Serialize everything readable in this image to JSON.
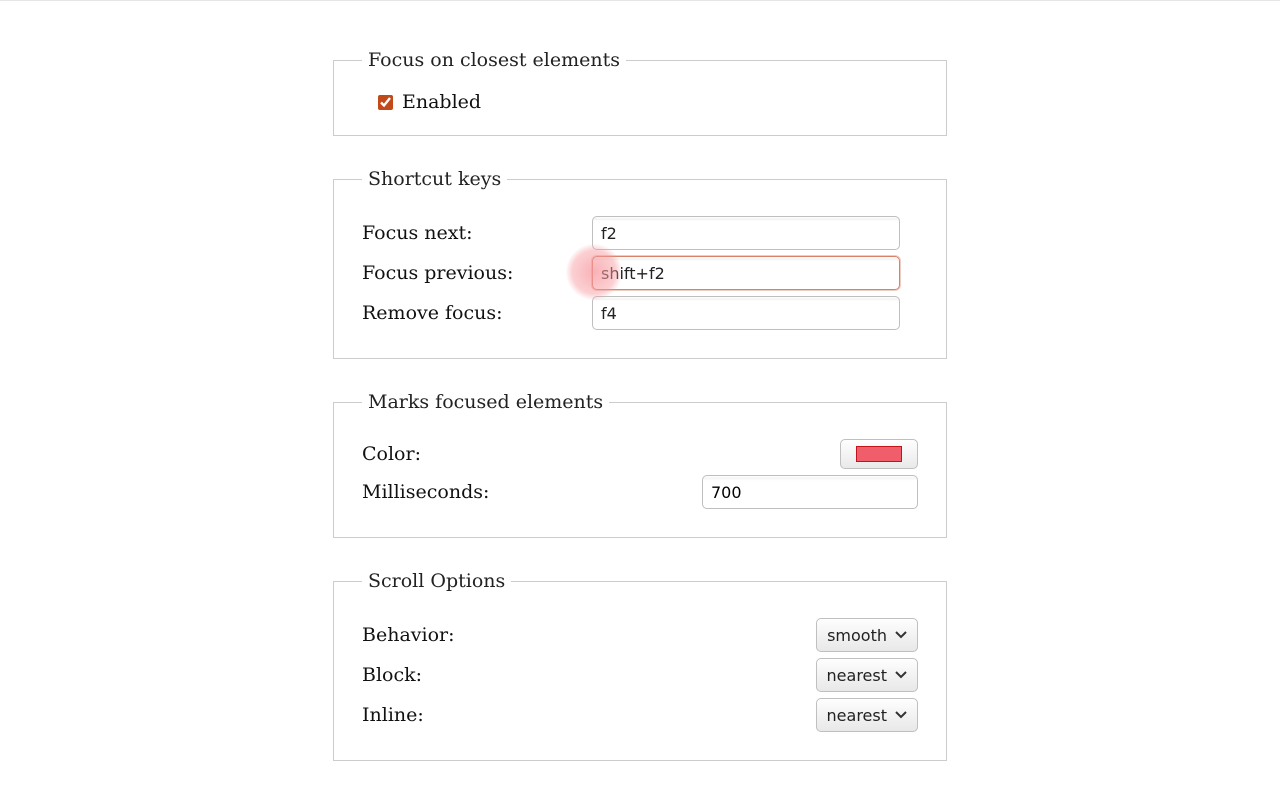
{
  "focusClosest": {
    "legend": "Focus on closest elements",
    "enabled_label": "Enabled",
    "enabled_checked": true
  },
  "shortcuts": {
    "legend": "Shortcut keys",
    "focus_next_label": "Focus next:",
    "focus_next_value": "f2",
    "focus_prev_label": "Focus previous:",
    "focus_prev_value": "shift+f2",
    "remove_focus_label": "Remove focus:",
    "remove_focus_value": "f4"
  },
  "marks": {
    "legend": "Marks focused elements",
    "color_label": "Color:",
    "color_value": "#ef5e6a",
    "milliseconds_label": "Milliseconds:",
    "milliseconds_value": "700"
  },
  "scroll": {
    "legend": "Scroll Options",
    "behavior_label": "Behavior:",
    "behavior_value": "smooth",
    "block_label": "Block:",
    "block_value": "nearest",
    "inline_label": "Inline:",
    "inline_value": "nearest"
  }
}
